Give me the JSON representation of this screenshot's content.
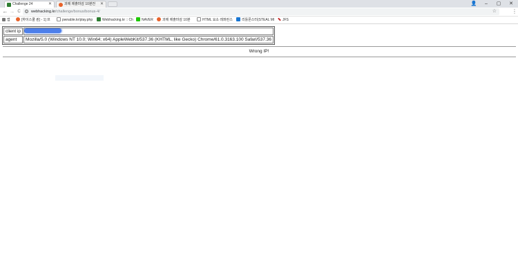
{
  "tabs": [
    {
      "title": "Challenge 24",
      "icon": "bug-icon",
      "active": true,
      "icon_color": "#2e7d32"
    },
    {
      "title": "과제 제출마감 10분전",
      "icon": "circle-logo-icon",
      "active": false,
      "icon_color": "#e8622a"
    }
  ],
  "window_controls": {
    "profile": "👤",
    "minimize": "–",
    "maximize": "▢",
    "close": "✕"
  },
  "toolbar": {
    "back": "←",
    "forward": "→",
    "reload": "C",
    "url_host": "webhacking.kr",
    "url_path": "/challenge/bonus/bonus-4/",
    "star": "☆",
    "menu": "⋮"
  },
  "bookmarks": [
    {
      "label": "앱",
      "icon": "apps-grid-icon",
      "color": "#777777"
    },
    {
      "label": "[하이스쿨 퀸] - 1] 프",
      "icon": "circle-logo-icon",
      "color": "#e8622a"
    },
    {
      "label": "pwnable.kr/play.php",
      "icon": "page-icon",
      "color": "#8a8a8a"
    },
    {
      "label": "Webhacking.kr :: Ch",
      "icon": "bug-icon",
      "color": "#2e7d32"
    },
    {
      "label": "NAVER",
      "icon": "naver-icon",
      "color": "#1ec800"
    },
    {
      "label": "과제 제출마감 10분",
      "icon": "circle-logo-icon",
      "color": "#e8622a"
    },
    {
      "label": "HTML 요소 레퍼런스",
      "icon": "page-icon",
      "color": "#8a8a8a"
    },
    {
      "label": "리틀몬스터(STEAL MI",
      "icon": "m-logo-icon",
      "color": "#1976d2"
    },
    {
      "label": "JFS",
      "icon": "wrench-icon",
      "color": "#c62828"
    }
  ],
  "page": {
    "rows": [
      {
        "key": "client ip",
        "value": ""
      },
      {
        "key": "agent",
        "value": "Mozilla/5.0 (Windows NT 10.0; Win64; x64) AppleWebKit/537.36 (KHTML, like Gecko) Chrome/61.0.3163.100 Safari/537.36"
      }
    ],
    "message": "Wrong IP!"
  }
}
